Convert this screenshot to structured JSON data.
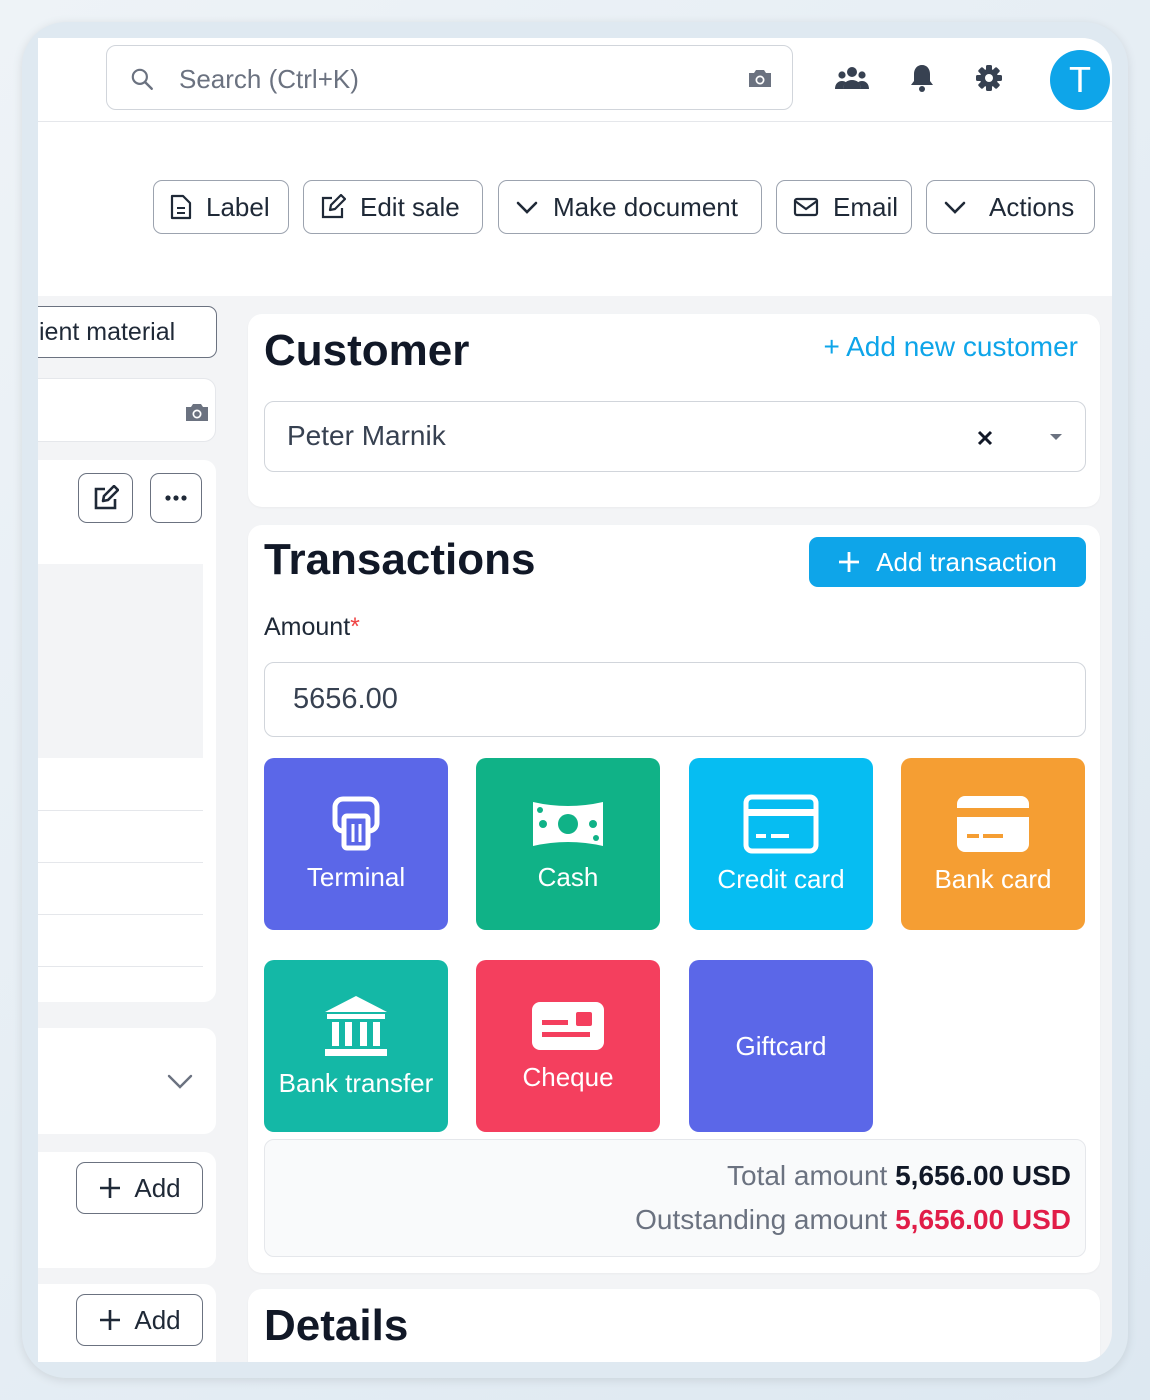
{
  "search": {
    "placeholder": "Search (Ctrl+K)"
  },
  "header_icons": [
    "users-icon",
    "bell-icon",
    "gear-icon",
    "camera-icon"
  ],
  "user": {
    "avatar_letter": "T",
    "avatar_color": "#0ea5e9"
  },
  "toolbar": {
    "label": "Label",
    "edit_sale": "Edit sale",
    "make_document": "Make document",
    "email": "Email",
    "actions": "Actions"
  },
  "left_panel": {
    "material_tab": "ient material",
    "add_label_1": "Add",
    "add_label_2": "Add"
  },
  "customer": {
    "title": "Customer",
    "add_link": "+ Add new customer",
    "selected": "Peter Marnik"
  },
  "transactions": {
    "title": "Transactions",
    "add_button": "Add transaction",
    "amount_label": "Amount",
    "required_mark": "*",
    "amount_value": "5656.00",
    "methods": [
      {
        "label": "Terminal",
        "color": "#5b67e8",
        "icon": "terminal-icon"
      },
      {
        "label": "Cash",
        "color": "#10b287",
        "icon": "cash-icon"
      },
      {
        "label": "Credit card",
        "color": "#06bdf2",
        "icon": "credit-card-icon"
      },
      {
        "label": "Bank card",
        "color": "#f59e33",
        "icon": "bank-card-icon"
      },
      {
        "label": "Bank transfer",
        "color": "#14b8a6",
        "icon": "bank-icon"
      },
      {
        "label": "Cheque",
        "color": "#f43f5e",
        "icon": "cheque-icon"
      },
      {
        "label": "Giftcard",
        "color": "#5b67e8",
        "icon": ""
      }
    ],
    "total_label": "Total amount",
    "total_value": "5,656.00 USD",
    "outstanding_label": "Outstanding amount",
    "outstanding_value": "5,656.00 USD",
    "outstanding_color": "#e11d48"
  },
  "details": {
    "title": "Details"
  }
}
